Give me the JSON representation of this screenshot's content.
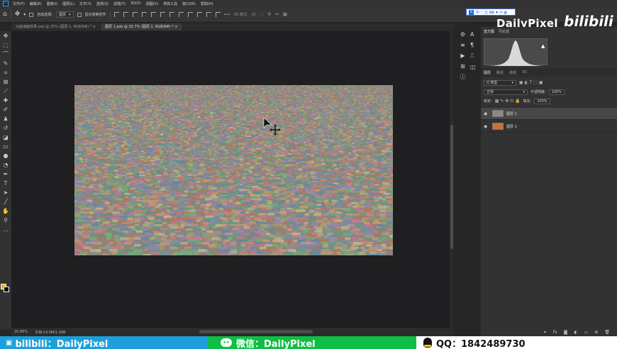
{
  "menu": [
    "文件(F)",
    "编辑(E)",
    "图像(I)",
    "图层(L)",
    "文字(Y)",
    "选择(S)",
    "滤镜(T)",
    "3D(D)",
    "视图(V)",
    "增效工具",
    "窗口(W)",
    "帮助(H)"
  ],
  "options": {
    "auto_select_label": "自动选择:",
    "auto_select_value": "图层",
    "show_transform_label": "显示变换控件",
    "mode_3d": "3D 模式:"
  },
  "ime": {
    "s": "S",
    "glyphs": "中 ⁰, ☺ ⌨ ♦ ✉ ▦"
  },
  "brand": {
    "name": "DailyPixel",
    "site": "bilibili"
  },
  "tabs": [
    {
      "label": "水面海面效果.psd @ 25% (图层 1, RGB/8#) *",
      "active": false
    },
    {
      "label": "图层 1.psb @ 20.7% (图层 2, RGB/8#) *",
      "active": true
    }
  ],
  "status": {
    "zoom": "20.66%",
    "doc": "文档:14.0M/1.36B"
  },
  "right_panels": {
    "top_tabs": [
      "直方图",
      "导航器"
    ],
    "layer_tabs": [
      "图层",
      "路径",
      "通道",
      "3D"
    ],
    "kind_label": "Q 类型",
    "blend_mode": "正常",
    "opacity_label": "不透明度:",
    "opacity_value": "100%",
    "lock_label": "锁定:",
    "fill_label": "填充:",
    "fill_value": "100%",
    "layers": [
      {
        "name": "图层 2",
        "selected": true,
        "thumb_color": "#8a8a8a"
      },
      {
        "name": "图层 1",
        "selected": false,
        "thumb_color": "#c8723a"
      }
    ]
  },
  "banner": {
    "bili_text": "bilibili：DailyPixel",
    "wechat_text": "微信：DailyPixel",
    "qq_text": "QQ：1842489730"
  }
}
